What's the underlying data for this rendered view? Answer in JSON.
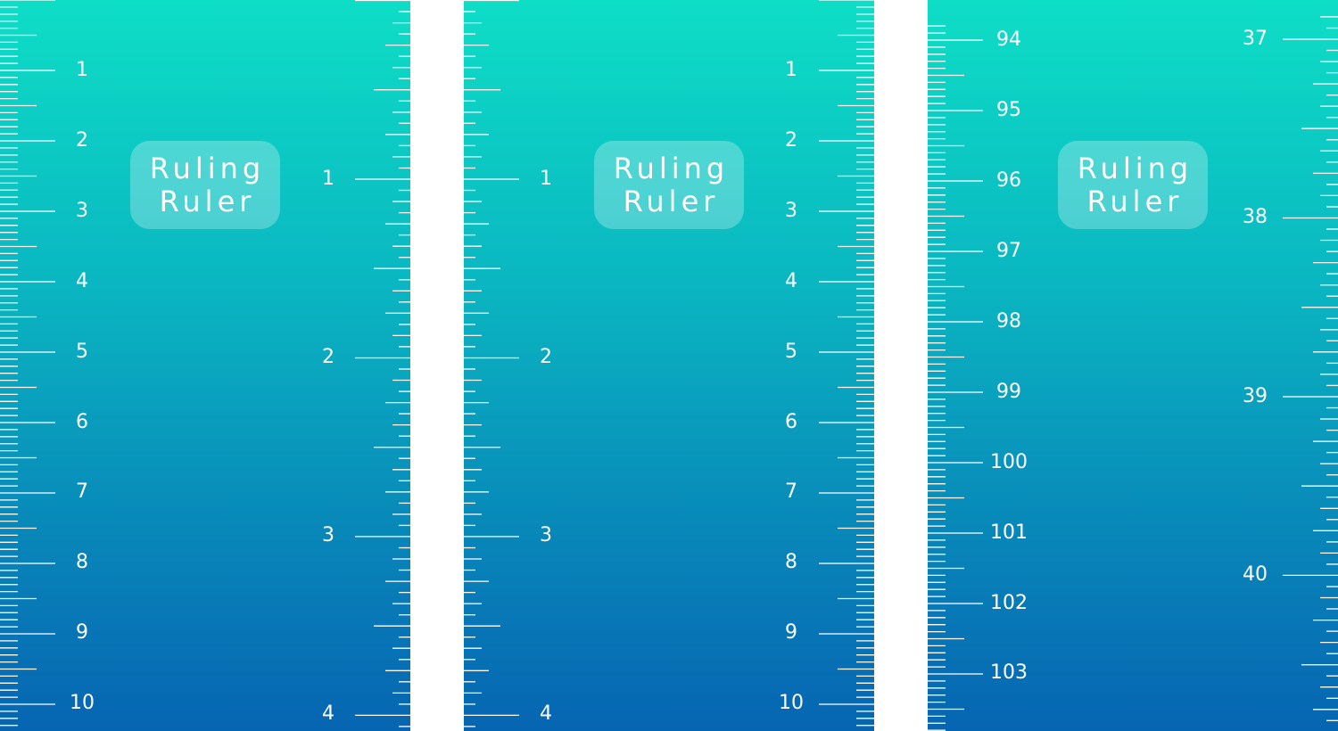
{
  "badge": {
    "line1": "Ruling",
    "line2": "Ruler"
  },
  "colors": {
    "gradient_top": "#0edec6",
    "gradient_bottom": "#0665b2",
    "tick": "#ffffff",
    "divider": "#ffffff"
  },
  "panels": [
    {
      "name": "panel-1",
      "cm_scale": {
        "labels": [
          "1",
          "2",
          "3",
          "4",
          "5",
          "6",
          "7",
          "8",
          "9",
          "10"
        ]
      },
      "inch_scale": {
        "labels": [
          "1",
          "2",
          "3",
          "4"
        ]
      }
    },
    {
      "name": "panel-2",
      "inch_scale": {
        "labels": [
          "1",
          "2",
          "3",
          "4"
        ]
      },
      "cm_scale": {
        "labels": [
          "1",
          "2",
          "3",
          "4",
          "5",
          "6",
          "7",
          "8",
          "9",
          "10"
        ]
      }
    },
    {
      "name": "panel-3",
      "cm_scale": {
        "labels": [
          "94",
          "95",
          "96",
          "97",
          "98",
          "99",
          "100",
          "101",
          "102",
          "103"
        ]
      },
      "inch_scale": {
        "labels": [
          "37",
          "38",
          "39",
          "40"
        ]
      }
    }
  ]
}
